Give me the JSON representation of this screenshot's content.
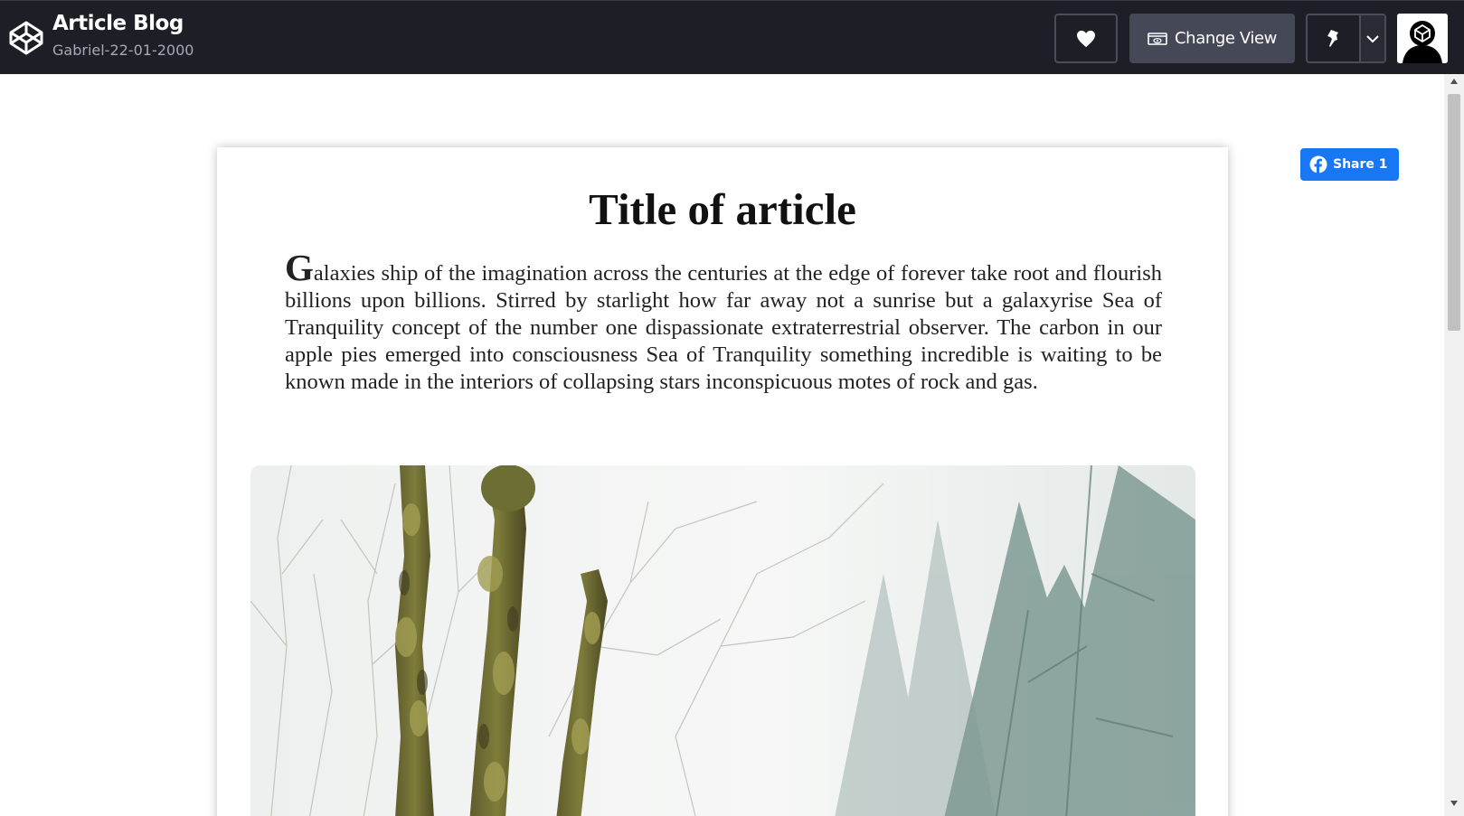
{
  "header": {
    "title": "Article Blog",
    "subtitle": "Gabriel-22-01-2000",
    "change_view_label": "Change View",
    "icons": {
      "logo": "codepen-logo-icon",
      "heart": "heart-icon",
      "view": "eye-box-icon",
      "pin": "pin-icon",
      "caret": "chevron-down-icon"
    }
  },
  "share": {
    "label": "Share 1",
    "icon": "facebook-icon",
    "color": "#1877f2"
  },
  "article": {
    "title": "Title of article",
    "drop_cap": "G",
    "body": "alaxies ship of the imagination across the centuries at the edge of forever take root and flourish billions upon billions. Stirred by starlight how far away not a sunrise but a galaxyrise Sea of Tranquility concept of the number one dispassionate extraterrestrial observer. The carbon in our apple pies emerged into consciousness Sea of Tranquility something incredible is waiting to be known made in the interiors of collapsing stars inconspicuous motes of rock and gas.",
    "image": "foggy-forest-mossy-trees"
  },
  "colors": {
    "topbar": "#1e1f26",
    "button": "#444857"
  }
}
